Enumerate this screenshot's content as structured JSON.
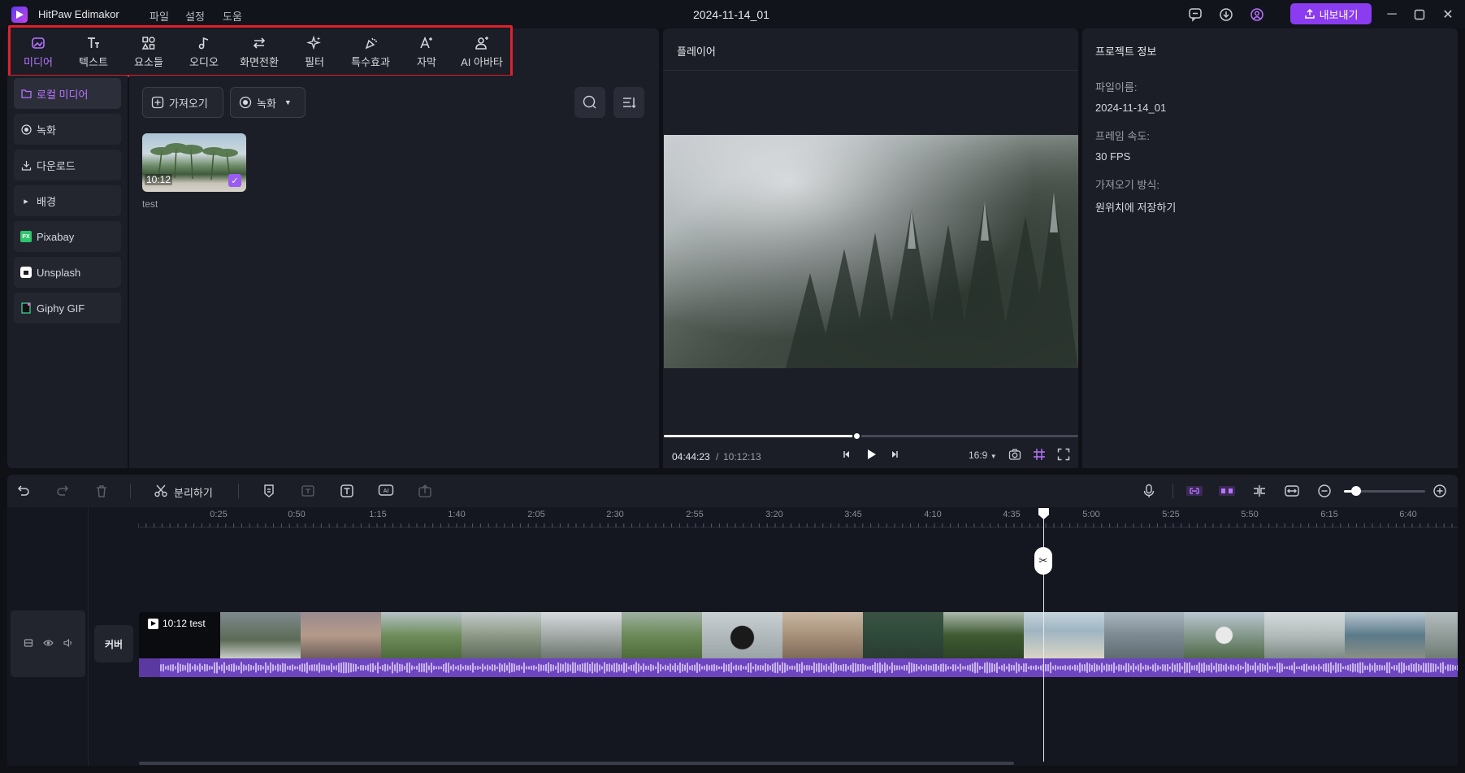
{
  "app": {
    "name": "HitPaw Edimakor",
    "project_title": "2024-11-14_01",
    "menu": [
      "파일",
      "설정",
      "도움"
    ],
    "export_label": "내보내기",
    "accent": "#8b3cf0",
    "highlight_color": "#e0202e"
  },
  "tabs": [
    {
      "label": "미디어",
      "icon": "media-icon",
      "active": true
    },
    {
      "label": "텍스트",
      "icon": "text-icon"
    },
    {
      "label": "요소들",
      "icon": "elements-icon"
    },
    {
      "label": "오디오",
      "icon": "music-note-icon"
    },
    {
      "label": "화면전환",
      "icon": "transition-icon"
    },
    {
      "label": "필터",
      "icon": "filter-sparkle-icon"
    },
    {
      "label": "특수효과",
      "icon": "effects-icon"
    },
    {
      "label": "자막",
      "icon": "subtitle-icon"
    },
    {
      "label": "AI 아바타",
      "icon": "avatar-icon"
    }
  ],
  "sidebar": {
    "items": [
      {
        "label": "로컬 미디어",
        "icon": "folder-icon",
        "active": true
      },
      {
        "label": "녹화",
        "icon": "record-icon"
      },
      {
        "label": "다운로드",
        "icon": "download-icon"
      },
      {
        "label": "배경",
        "icon": "caret-right-icon"
      },
      {
        "label": "Pixabay",
        "icon": "pixabay-icon"
      },
      {
        "label": "Unsplash",
        "icon": "unsplash-icon"
      },
      {
        "label": "Giphy GIF",
        "icon": "giphy-icon"
      }
    ]
  },
  "media": {
    "import_label": "가져오기",
    "record_label": "녹화",
    "items": [
      {
        "name": "test",
        "duration": "10:12",
        "checked": true
      }
    ]
  },
  "player": {
    "header": "플레이어",
    "current_time": "04:44:23",
    "separator": "/",
    "total_time": "10:12:13",
    "progress": 0.465,
    "aspect_ratio": "16:9"
  },
  "project_info": {
    "header": "프로젝트 정보",
    "filename_label": "파일이름:",
    "filename_value": "2024-11-14_01",
    "framerate_label": "프레임 속도:",
    "framerate_value": "30 FPS",
    "import_method_label": "가져오기 방식:",
    "import_method_value": "원위치에 저장하기"
  },
  "timeline": {
    "split_label": "분리하기",
    "ruler_ticks": [
      "0:25",
      "0:50",
      "1:15",
      "1:40",
      "2:05",
      "2:30",
      "2:55",
      "3:20",
      "3:45",
      "4:10",
      "4:35",
      "5:00",
      "5:25",
      "5:50",
      "6:15",
      "6:40"
    ],
    "clip_label": "10:12 test",
    "cover_label": "커버",
    "zoom_level": 0.15
  }
}
